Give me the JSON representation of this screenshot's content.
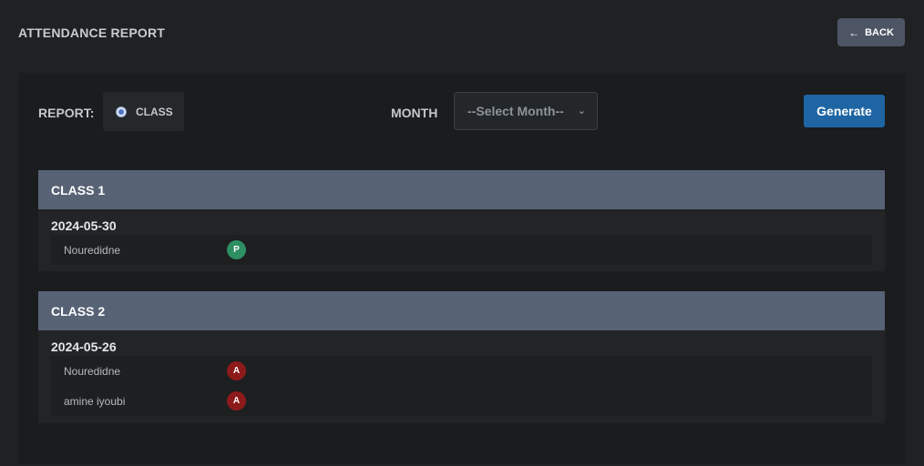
{
  "header": {
    "title": "ATTENDANCE REPORT",
    "back_label": "BACK"
  },
  "filters": {
    "report_label": "REPORT:",
    "report_option": "CLASS",
    "month_label": "MONTH",
    "month_select_value": "--Select Month--",
    "generate_label": "Generate"
  },
  "classes": [
    {
      "name": "CLASS 1",
      "date": "2024-05-30",
      "students": [
        {
          "name": "Nouredidne",
          "status": "P",
          "status_color": "#2d8f62"
        }
      ]
    },
    {
      "name": "CLASS 2",
      "date": "2024-05-26",
      "students": [
        {
          "name": "Nouredidne",
          "status": "A",
          "status_color": "#8d1a1a"
        },
        {
          "name": "amine iyoubi",
          "status": "A",
          "status_color": "#8d1a1a"
        }
      ]
    }
  ],
  "colors": {
    "background": "#1f2123",
    "accent": "#1f65a3",
    "present": "#2d8f62",
    "absent": "#8d1a1a",
    "class_header": "#576275"
  }
}
